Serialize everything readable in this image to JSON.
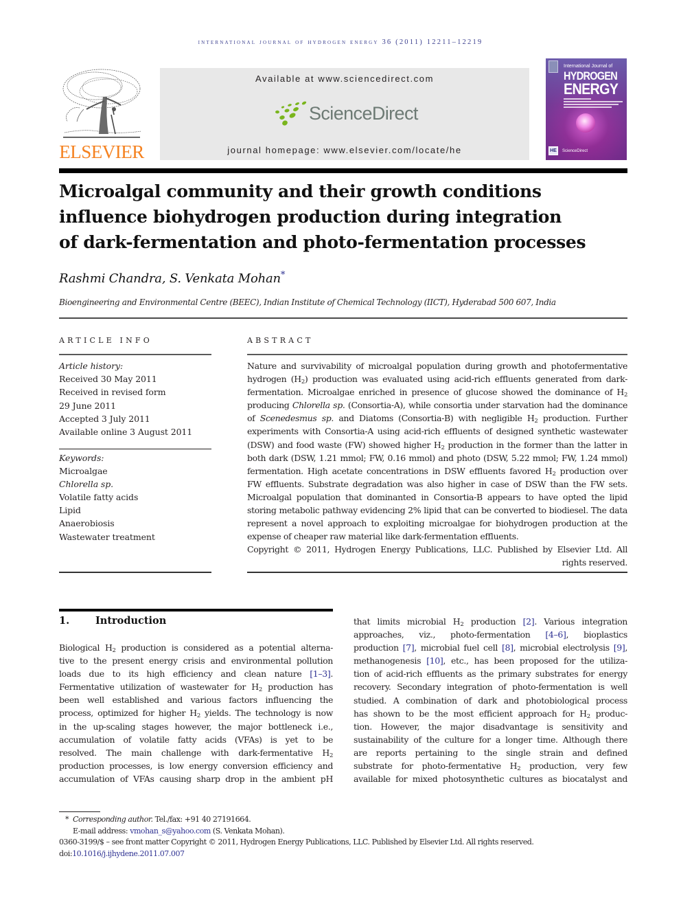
{
  "running_head": "INTERNATIONAL JOURNAL OF HYDROGEN ENERGY 36 (2011) 12211–12219",
  "header": {
    "publisher_logo_text": "ELSEVIER",
    "available_at": "Available at www.sciencedirect.com",
    "sciencedirect_logo_text": "ScienceDirect",
    "journal_homepage": "journal homepage: www.elsevier.com/locate/he",
    "cover": {
      "title_small": "International Journal of",
      "title_line1": "HYDROGEN",
      "title_line2": "ENERGY",
      "badge": "HE",
      "footer_logo": "ScienceDirect"
    },
    "colors": {
      "elsevier_orange": "#f58220",
      "sciencedirect_green": "#7ab51d",
      "sciencedirect_gray": "#6d7a74",
      "link_blue": "#2e3192",
      "panel_gray": "#e8e8e8"
    }
  },
  "article": {
    "title_lines": [
      "Microalgal community and their growth conditions",
      "influence biohydrogen production during integration",
      "of dark-fermentation and photo-fermentation processes"
    ],
    "authors": "Rashmi Chandra, S. Venkata Mohan",
    "author_marker": "*",
    "affiliation": "Bioengineering and Environmental Centre (BEEC), Indian Institute of Chemical Technology (IICT), Hyderabad 500 607, India"
  },
  "article_info": {
    "label": "ARTICLE INFO",
    "history_label": "Article history:",
    "history": [
      "Received 30 May 2011",
      "Received in revised form",
      "29 June 2011",
      "Accepted 3 July 2011",
      "Available online 3 August 2011"
    ],
    "keywords_label": "Keywords:",
    "keywords": [
      {
        "text": "Microalgae",
        "italic": false
      },
      {
        "text": "Chlorella sp.",
        "italic": true
      },
      {
        "text": "Volatile fatty acids",
        "italic": false
      },
      {
        "text": "Lipid",
        "italic": false
      },
      {
        "text": "Anaerobiosis",
        "italic": false
      },
      {
        "text": "Wastewater treatment",
        "italic": false
      }
    ]
  },
  "abstract": {
    "label": "ABSTRACT",
    "lines": [
      "Nature and survivability of microalgal population during growth and photofermentative",
      "hydrogen (H₂) production was evaluated using acid-rich effluents generated from dark-",
      "fermentation. Microalgae enriched in presence of glucose showed the dominance of H₂",
      "producing Chlorella sp. (Consortia-A), while consortia under starvation had the dominance",
      "of Scenedesmus sp. and Diatoms (Consortia-B) with negligible H₂ production. Further",
      "experiments with Consortia-A using acid-rich effluents of designed synthetic wastewater",
      "(DSW) and food waste (FW) showed higher H₂ production in the former than the latter in",
      "both dark (DSW, 1.21 mmol; FW, 0.16 mmol) and photo (DSW, 5.22 mmol; FW, 1.24 mmol)",
      "fermentation. High acetate concentrations in DSW effluents favored H₂ production over",
      "FW effluents. Substrate degradation was also higher in case of DSW than the FW sets.",
      "Microalgal population that dominanted in Consortia-B appears to have opted the lipid",
      "storing metabolic pathway evidencing 2% lipid that can be converted to biodiesel. The data",
      "represent a novel approach to exploiting microalgae for biohydrogen production at the",
      "expense of cheaper raw material like dark-fermentation effluents."
    ],
    "copyright": "Copyright © 2011, Hydrogen Energy Publications, LLC. Published by Elsevier Ltd. All rights reserved."
  },
  "introduction": {
    "number": "1.",
    "heading": "Introduction",
    "left_lines": [
      "Biological H₂ production is considered as a potential alterna-",
      "tive to the present energy crisis and environmental pollution",
      "loads due to its high efficiency and clean nature [1–3].",
      "Fermentative utilization of wastewater for H₂ production has",
      "been well established and various factors influencing the",
      "process, optimized for higher H₂ yields. The technology is now",
      "in the up-scaling stages however, the major bottleneck i.e.,",
      "accumulation of volatile fatty acids (VFAs) is yet to be",
      "resolved. The main challenge with dark-fermentative H₂",
      "production processes, is low energy conversion efficiency and",
      "accumulation of VFAs causing sharp drop in the ambient pH"
    ],
    "right_lines": [
      "that limits microbial H₂ production [2]. Various integration",
      "approaches, viz., photo-fermentation [4–6], bioplastics",
      "production [7], microbial fuel cell [8], microbial electrolysis [9],",
      "methanogenesis [10], etc., has been proposed for the utiliza-",
      "tion of acid-rich effluents as the primary substrates for energy",
      "recovery. Secondary integration of photo-fermentation is well",
      "studied. A combination of dark and photobiological process",
      "has shown to be the most efficient approach for H₂ produc-",
      "tion. However, the major disadvantage is sensitivity and",
      "sustainability of the culture for a longer time. Although there",
      "are reports pertaining to the single strain and defined",
      "substrate for photo-fermentative H₂ production, very few",
      "available for mixed photosynthetic cultures as biocatalyst and"
    ],
    "references": [
      "[1–3]",
      "[2]",
      "[4–6]",
      "[7]",
      "[8]",
      "[9]",
      "[10]"
    ]
  },
  "footnotes": {
    "marker": "*",
    "corresponding_label": "Corresponding author.",
    "tel": "Tel./fax: +91 40 27191664.",
    "email_label": "E-mail address:",
    "email": "vmohan_s@yahoo.com",
    "email_suffix": "(S. Venkata Mohan).",
    "issn_line": "0360-3199/$ – see front matter Copyright © 2011, Hydrogen Energy Publications, LLC. Published by Elsevier Ltd. All rights reserved.",
    "doi_label": "doi:",
    "doi": "10.1016/j.ijhydene.2011.07.007"
  }
}
